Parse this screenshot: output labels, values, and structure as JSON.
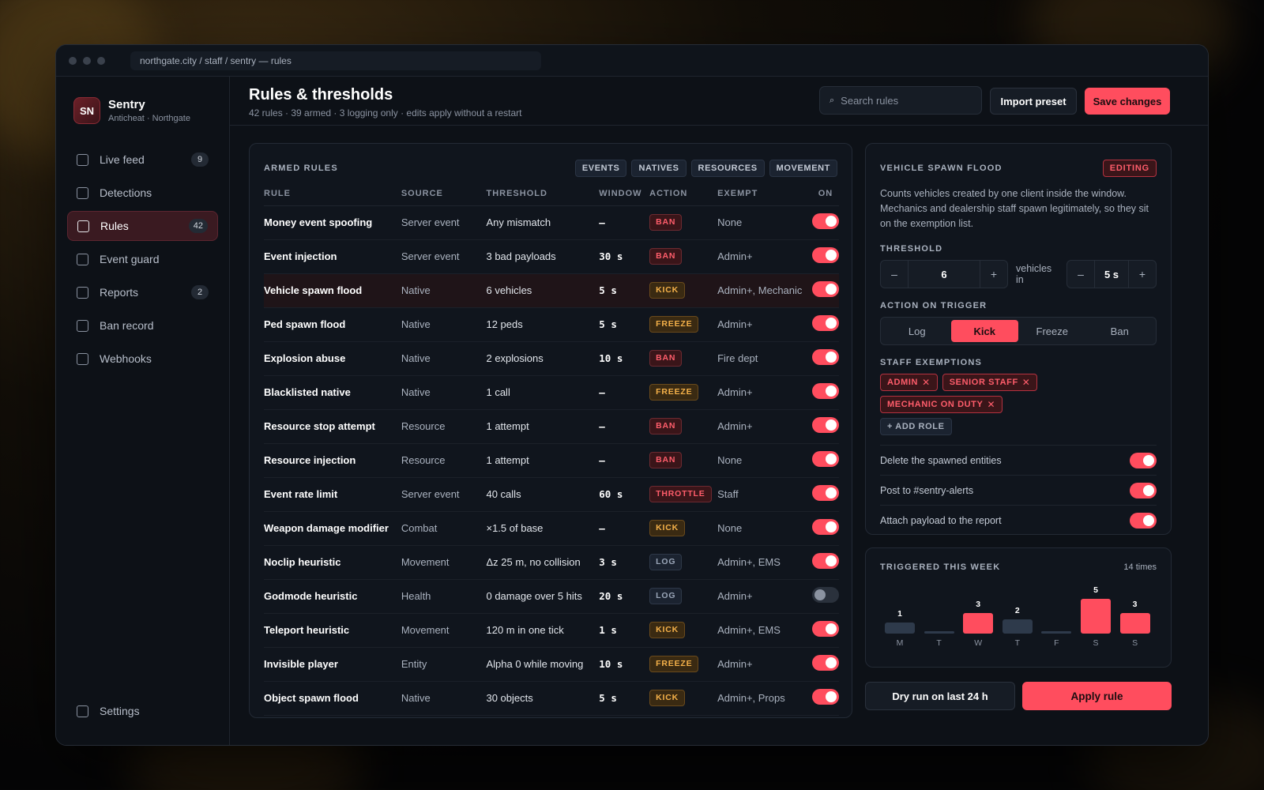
{
  "window": {
    "url": "northgate.city / staff / sentry — rules"
  },
  "brand": {
    "initials": "SN",
    "name": "Sentry",
    "subtitle": "Anticheat · Northgate"
  },
  "nav": [
    {
      "label": "Live feed",
      "count": "9"
    },
    {
      "label": "Detections",
      "count": ""
    },
    {
      "label": "Rules",
      "count": "42",
      "active": true
    },
    {
      "label": "Event guard",
      "count": ""
    },
    {
      "label": "Reports",
      "count": "2"
    },
    {
      "label": "Ban record",
      "count": ""
    },
    {
      "label": "Webhooks",
      "count": ""
    }
  ],
  "settings_label": "Settings",
  "header": {
    "title": "Rules & thresholds",
    "subtitle": "42 rules · 39 armed · 3 logging only · edits apply without a restart",
    "search_placeholder": "Search rules",
    "import_label": "Import preset",
    "save_label": "Save changes"
  },
  "rules_panel": {
    "title": "ARMED RULES",
    "filters": [
      "EVENTS",
      "NATIVES",
      "RESOURCES",
      "MOVEMENT"
    ],
    "columns": [
      "RULE",
      "SOURCE",
      "THRESHOLD",
      "WINDOW",
      "ACTION",
      "EXEMPT",
      "ON"
    ],
    "rows": [
      {
        "rule": "Money event spoofing",
        "source": "Server event",
        "threshold": "Any mismatch",
        "window": "—",
        "action": "BAN",
        "exempt": "None",
        "on": true
      },
      {
        "rule": "Event injection",
        "source": "Server event",
        "threshold": "3 bad payloads",
        "window": "30 s",
        "action": "BAN",
        "exempt": "Admin+",
        "on": true
      },
      {
        "rule": "Vehicle spawn flood",
        "source": "Native",
        "threshold": "6 vehicles",
        "window": "5 s",
        "action": "KICK",
        "exempt": "Admin+, Mechanic",
        "on": true,
        "selected": true
      },
      {
        "rule": "Ped spawn flood",
        "source": "Native",
        "threshold": "12 peds",
        "window": "5 s",
        "action": "FREEZE",
        "exempt": "Admin+",
        "on": true
      },
      {
        "rule": "Explosion abuse",
        "source": "Native",
        "threshold": "2 explosions",
        "window": "10 s",
        "action": "BAN",
        "exempt": "Fire dept",
        "on": true
      },
      {
        "rule": "Blacklisted native",
        "source": "Native",
        "threshold": "1 call",
        "window": "—",
        "action": "FREEZE",
        "exempt": "Admin+",
        "on": true
      },
      {
        "rule": "Resource stop attempt",
        "source": "Resource",
        "threshold": "1 attempt",
        "window": "—",
        "action": "BAN",
        "exempt": "Admin+",
        "on": true
      },
      {
        "rule": "Resource injection",
        "source": "Resource",
        "threshold": "1 attempt",
        "window": "—",
        "action": "BAN",
        "exempt": "None",
        "on": true
      },
      {
        "rule": "Event rate limit",
        "source": "Server event",
        "threshold": "40 calls",
        "window": "60 s",
        "action": "THROTTLE",
        "exempt": "Staff",
        "on": true
      },
      {
        "rule": "Weapon damage modifier",
        "source": "Combat",
        "threshold": "×1.5 of base",
        "window": "—",
        "action": "KICK",
        "exempt": "None",
        "on": true
      },
      {
        "rule": "Noclip heuristic",
        "source": "Movement",
        "threshold": "Δz 25 m, no collision",
        "window": "3 s",
        "action": "LOG",
        "exempt": "Admin+, EMS",
        "on": true
      },
      {
        "rule": "Godmode heuristic",
        "source": "Health",
        "threshold": "0 damage over 5 hits",
        "window": "20 s",
        "action": "LOG",
        "exempt": "Admin+",
        "on": false
      },
      {
        "rule": "Teleport heuristic",
        "source": "Movement",
        "threshold": "120 m in one tick",
        "window": "1 s",
        "action": "KICK",
        "exempt": "Admin+, EMS",
        "on": true
      },
      {
        "rule": "Invisible player",
        "source": "Entity",
        "threshold": "Alpha 0 while moving",
        "window": "10 s",
        "action": "FREEZE",
        "exempt": "Admin+",
        "on": true
      },
      {
        "rule": "Object spawn flood",
        "source": "Native",
        "threshold": "30 objects",
        "window": "5 s",
        "action": "KICK",
        "exempt": "Admin+, Props",
        "on": true
      }
    ]
  },
  "detail": {
    "title": "VEHICLE SPAWN FLOOD",
    "status": "EDITING",
    "description": "Counts vehicles created by one client inside the window. Mechanics and dealership staff spawn legitimately, so they sit on the exemption list.",
    "threshold_label": "THRESHOLD",
    "threshold_value": "6",
    "threshold_mid": "vehicles in",
    "window_value": "5 s",
    "minus": "–",
    "plus": "+",
    "action_label": "ACTION ON TRIGGER",
    "actions": [
      "Log",
      "Kick",
      "Freeze",
      "Ban"
    ],
    "active_action": "Kick",
    "exemptions_label": "STAFF EXEMPTIONS",
    "exemptions": [
      "ADMIN",
      "SENIOR STAFF",
      "MECHANIC ON DUTY"
    ],
    "add_role": "+ ADD ROLE",
    "options": [
      {
        "label": "Delete the spawned entities",
        "on": true
      },
      {
        "label": "Post to #sentry-alerts",
        "on": true
      },
      {
        "label": "Attach payload to the report",
        "on": true
      }
    ]
  },
  "week": {
    "title": "TRIGGERED THIS WEEK",
    "total": "14 times",
    "chart_data": {
      "type": "bar",
      "categories": [
        "M",
        "T",
        "W",
        "T",
        "F",
        "S",
        "S"
      ],
      "values": [
        1,
        0,
        3,
        2,
        0,
        5,
        3
      ],
      "value_labels": [
        "1",
        "",
        "3",
        "2",
        "",
        "5",
        "3"
      ],
      "ylim": [
        0,
        5
      ]
    }
  },
  "footer": {
    "dry_run": "Dry run on last 24 h",
    "apply": "Apply rule"
  },
  "colors": {
    "accent": "#ff4d5e",
    "ban": "#ff5d6b",
    "kick": "#f6b24a",
    "bar_high": "#ff4d5e",
    "bar_low": "#2e3a4b"
  }
}
